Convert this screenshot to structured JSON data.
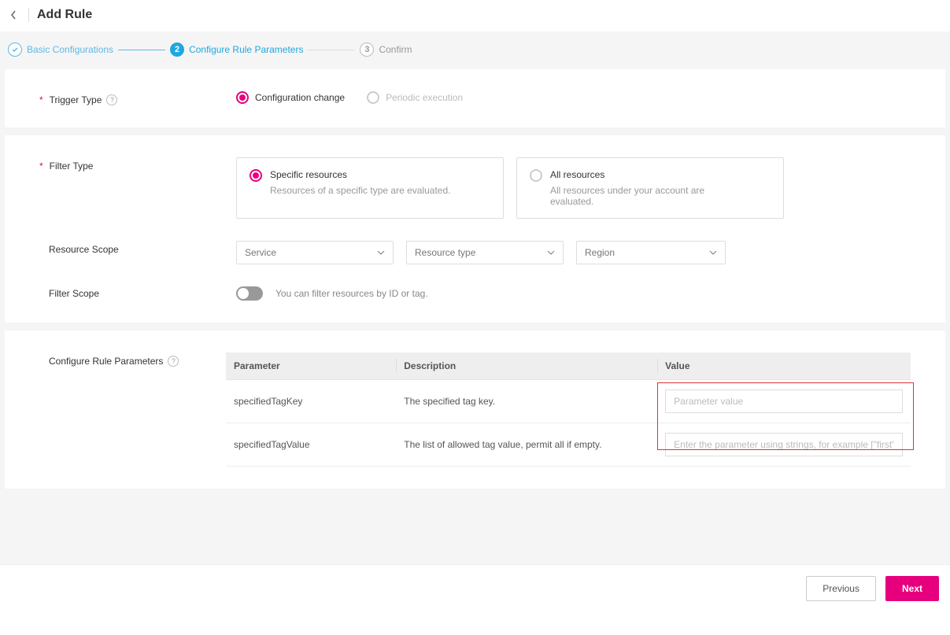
{
  "header": {
    "title": "Add Rule"
  },
  "stepper": {
    "step1": "Basic Configurations",
    "step2_num": "2",
    "step2": "Configure Rule Parameters",
    "step3_num": "3",
    "step3": "Confirm"
  },
  "trigger": {
    "label": "Trigger Type",
    "opt_config_change": "Configuration change",
    "opt_periodic": "Periodic execution"
  },
  "filter": {
    "label": "Filter Type",
    "specific_title": "Specific resources",
    "specific_sub": "Resources of a specific type are evaluated.",
    "all_title": "All resources",
    "all_sub": "All resources under your account are evaluated."
  },
  "scope": {
    "resource_label": "Resource Scope",
    "service_ph": "Service",
    "restype_ph": "Resource type",
    "region_ph": "Region",
    "filter_label": "Filter Scope",
    "filter_hint": "You can filter resources by ID or tag."
  },
  "params": {
    "label": "Configure Rule Parameters",
    "th_param": "Parameter",
    "th_desc": "Description",
    "th_value": "Value",
    "rows": [
      {
        "param": "specifiedTagKey",
        "desc": "The specified tag key.",
        "placeholder": "Parameter value"
      },
      {
        "param": "specifiedTagValue",
        "desc": "The list of allowed tag value, permit all if empty.",
        "placeholder": "Enter the parameter using strings, for example [\"first\", \"s"
      }
    ]
  },
  "footer": {
    "previous": "Previous",
    "next": "Next"
  },
  "glyph": {
    "help": "?",
    "check": "✓"
  }
}
